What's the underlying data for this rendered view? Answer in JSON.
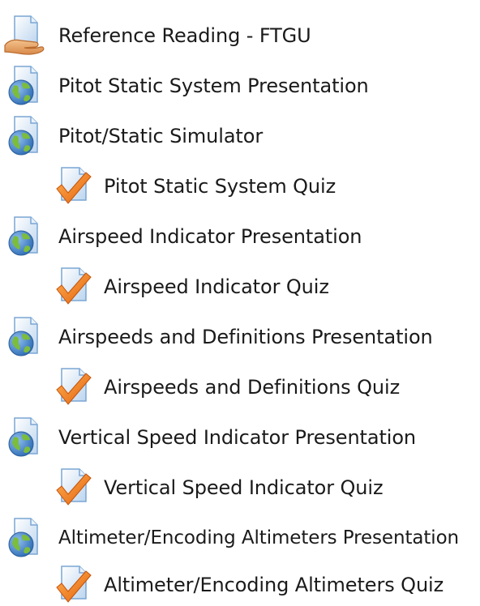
{
  "items": [
    {
      "label": "Reference Reading - FTGU",
      "icon": "book-hand-icon"
    },
    {
      "label": "Pitot Static System Presentation",
      "icon": "url-globe-icon"
    },
    {
      "label": "Pitot/Static Simulator",
      "icon": "url-globe-icon"
    },
    {
      "label": "Pitot Static System Quiz",
      "icon": "quiz-check-icon"
    },
    {
      "label": "Airspeed Indicator Presentation",
      "icon": "url-globe-icon"
    },
    {
      "label": "Airspeed Indicator Quiz",
      "icon": "quiz-check-icon"
    },
    {
      "label": "Airspeeds and Definitions Presentation",
      "icon": "url-globe-icon"
    },
    {
      "label": "Airspeeds and Definitions Quiz",
      "icon": "quiz-check-icon"
    },
    {
      "label": "Vertical Speed Indicator Presentation",
      "icon": "url-globe-icon"
    },
    {
      "label": "Vertical Speed Indicator Quiz",
      "icon": "quiz-check-icon"
    },
    {
      "label": "Altimeter/Encoding Altimeters Presentation",
      "icon": "url-globe-icon"
    },
    {
      "label": "Altimeter/Encoding Altimeters Quiz",
      "icon": "quiz-check-icon"
    }
  ],
  "colors": {
    "page_fill": "#cfe1f2",
    "page_stroke": "#7aa6d4",
    "globe_blue": "#3f7fc6",
    "globe_green": "#7cbd3b",
    "check_orange": "#f07b1e",
    "hand_skin": "#e8a666"
  }
}
